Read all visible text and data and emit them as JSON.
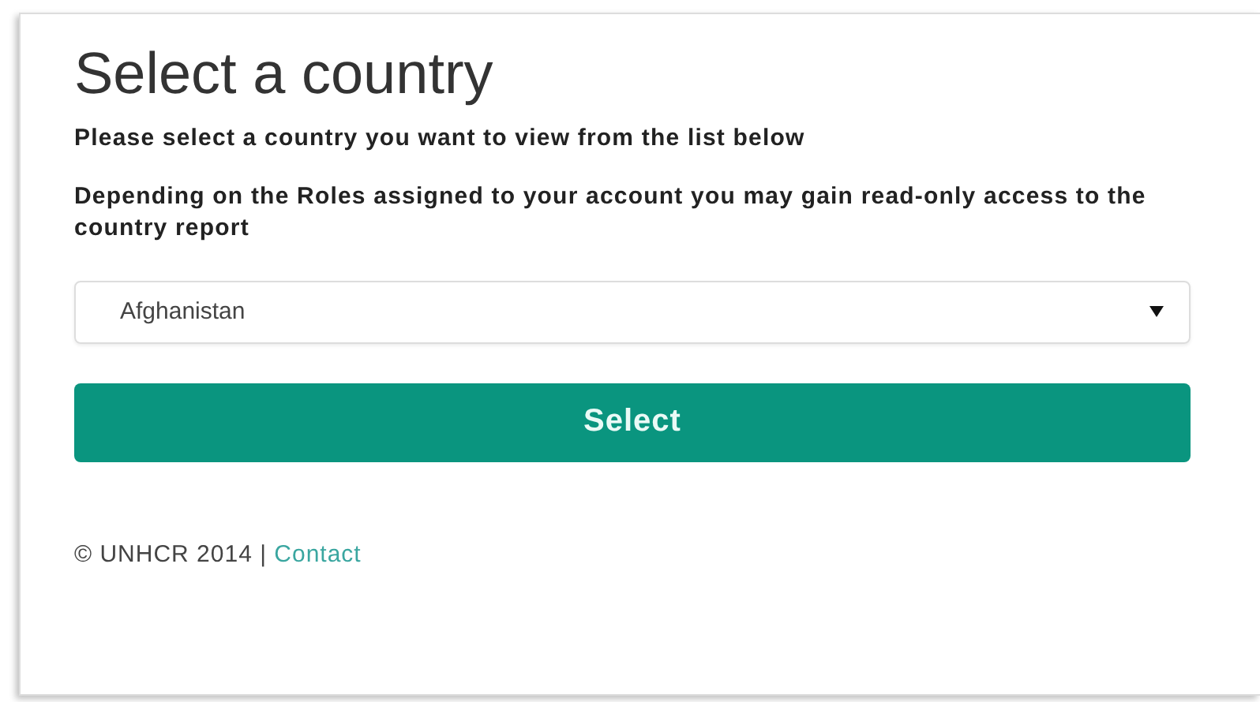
{
  "title": "Select a country",
  "paragraphs": [
    "Please select a country you want to view from the list below",
    "Depending on the Roles assigned to your account you may gain read-only access to the country report"
  ],
  "country_select": {
    "value": "Afghanistan"
  },
  "submit_button": "Select",
  "footer": {
    "text": "© UNHCR 2014 | ",
    "link": "Contact"
  }
}
